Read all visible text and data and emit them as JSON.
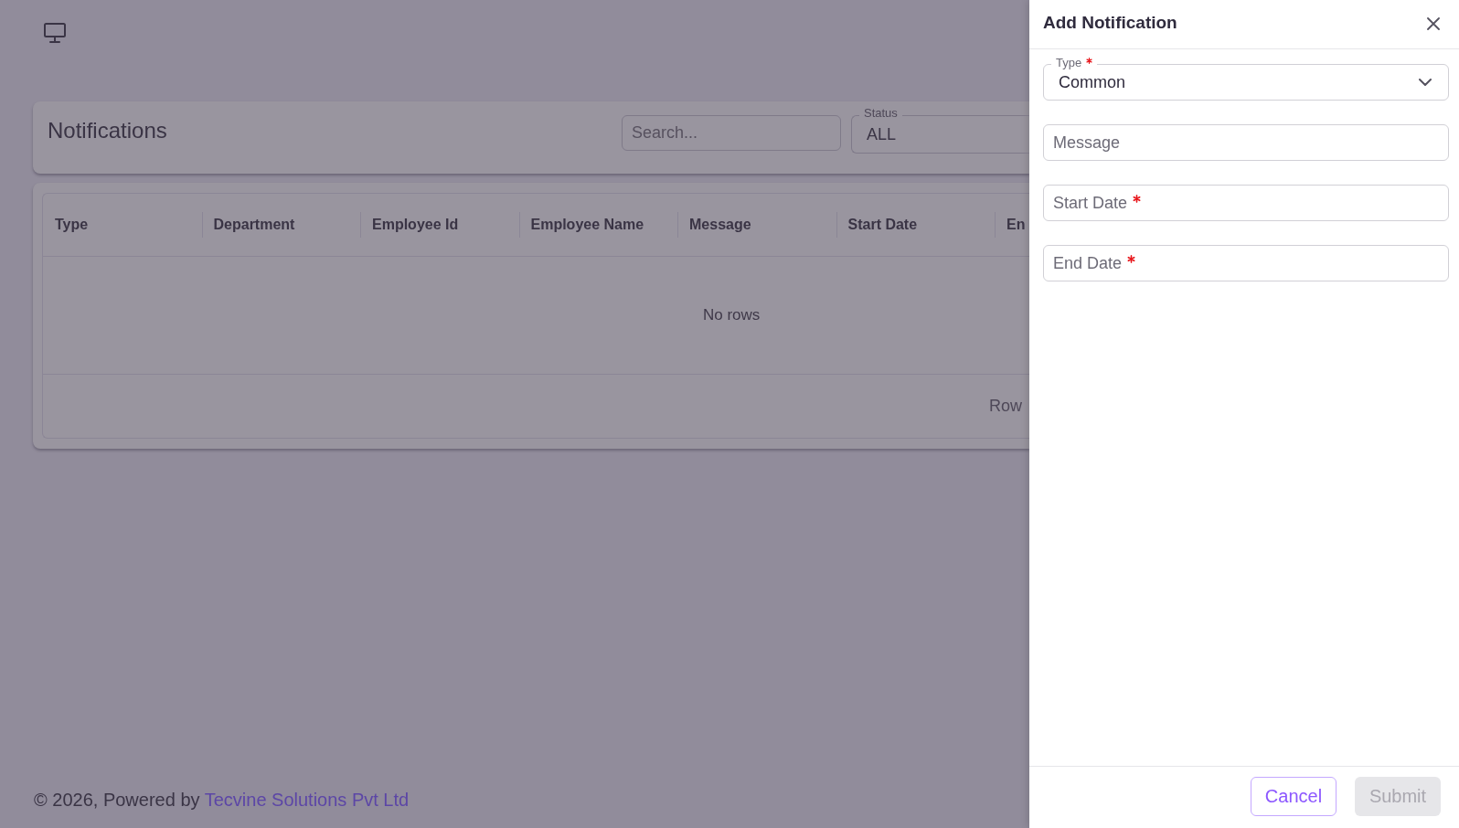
{
  "header": {
    "title": "Notifications",
    "search": {
      "placeholder": "Search..."
    },
    "status_filter": {
      "label": "Status",
      "value": "ALL"
    }
  },
  "table": {
    "columns": [
      "Type",
      "Department",
      "Employee Id",
      "Employee Name",
      "Message",
      "Start Date",
      "En"
    ],
    "empty_message": "No rows",
    "footer": {
      "rows_label": "Row"
    }
  },
  "footer": {
    "text": "© 2026, Powered by",
    "link": "Tecvine Solutions Pvt Ltd"
  },
  "drawer": {
    "title": "Add Notification",
    "fields": [
      {
        "kind": "select",
        "label": "Type",
        "required": true,
        "value": "Common"
      },
      {
        "kind": "text",
        "label": "Message",
        "required": false
      },
      {
        "kind": "date",
        "label": "Start Date",
        "required": true
      },
      {
        "kind": "date",
        "label": "End Date",
        "required": true
      }
    ],
    "buttons": [
      {
        "kind": "outline",
        "label": "Cancel",
        "disabled": false
      },
      {
        "kind": "primary",
        "label": "Submit",
        "disabled": true
      }
    ]
  }
}
